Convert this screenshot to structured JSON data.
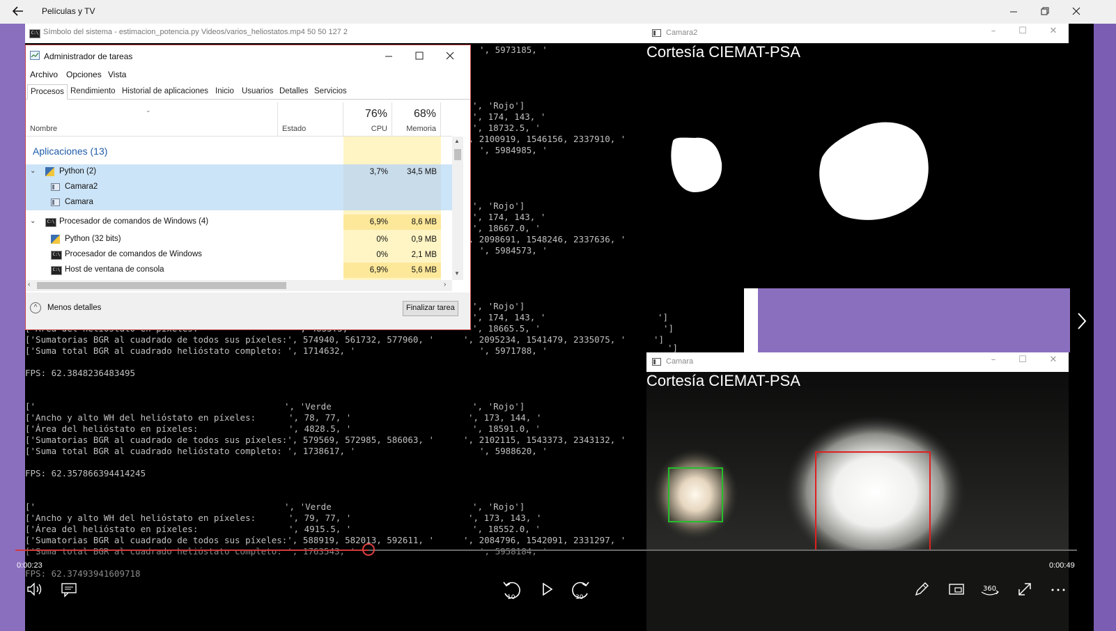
{
  "app": {
    "title": "Películas y TV",
    "back_icon": "arrow-left-icon",
    "caption_buttons": [
      "minimize",
      "restore",
      "close"
    ]
  },
  "console": {
    "title": "Símbolo del sistema - estimacion_potencia.py  Videos/varios_heliostatos.mp4 50 50 127 2",
    "lines": [
      {
        "left": "",
        "right": "', 5973185, '"
      },
      {
        "left": "",
        "right": "', 'Rojo']"
      },
      {
        "left": "",
        "right": "', 174, 143, '"
      },
      {
        "left": "",
        "right": "', 18732.5, '"
      },
      {
        "left": "",
        "right": "', 2100919, 1546156, 2337910, '"
      },
      {
        "left": "",
        "right": "', 5984985, '"
      },
      {
        "left": "",
        "right": "', 'Rojo']"
      },
      {
        "left": "",
        "right": "', 174, 143, '"
      },
      {
        "left": "",
        "right": "', 18667.0, '"
      },
      {
        "left": "",
        "right": "', 2098691, 1548246, 2337636, '"
      },
      {
        "left": "",
        "right": "', 5984573, '"
      },
      {
        "left": "",
        "right": "', 'Rojo']"
      },
      {
        "left": "",
        "right": "', 174, 143, '"
      },
      {
        "left": "['Área del helióstato en píxeles:",
        "mid": "', 4835.5, '",
        "right": "', 18665.5, '"
      },
      {
        "left": "['Sumatorias BGR al cuadrado de todos sus píxeles:', 574940, 561732, 577960, '",
        "right": "', 2095234, 1541479, 2335075, '"
      },
      {
        "left": "['Suma total BGR al cuadrado helióstato completo: ', 1714632, '",
        "right": "', 5971788, '"
      },
      {
        "left": "FPS: 62.3848236483495",
        "right": ""
      },
      {
        "left": "['",
        "mid": "', 'Verde",
        "right": "', 'Rojo']"
      },
      {
        "left": "['Ancho y alto WH del helióstato en píxeles:",
        "mid": "', 78, 77, '",
        "right": "', 173, 144, '"
      },
      {
        "left": "['Área del helióstato en píxeles:",
        "mid": "', 4828.5, '",
        "right": "', 18591.0, '"
      },
      {
        "left": "['Sumatorias BGR al cuadrado de todos sus píxeles:', 579569, 572985, 586063, '",
        "right": "', 2102115, 1543373, 2343132, '"
      },
      {
        "left": "['Suma total BGR al cuadrado helióstato completo: ', 1738617, '",
        "right": "', 5988620, '"
      },
      {
        "left": "FPS: 62.357866394414245",
        "right": ""
      },
      {
        "left": "['",
        "mid": "', 'Verde",
        "right": "', 'Rojo']"
      },
      {
        "left": "['Ancho y alto WH del helióstato en píxeles:",
        "mid": "', 79, 77, '",
        "right": "', 173, 143, '"
      },
      {
        "left": "['Área del helióstato en píxeles:",
        "mid": "', 4915.5, '",
        "right": "', 18552.0, '"
      },
      {
        "left": "['Sumatorias BGR al cuadrado de todos sus píxeles:', 588919, 582013, 592611, '",
        "right": "', 2084796, 1542091, 2331297, '"
      },
      {
        "left": "['Suma total BGR al cuadrado helióstato completo: ', 1763543, '",
        "right": "', 5958184, '"
      },
      {
        "left": "FPS: 62.37493941609718",
        "right": ""
      }
    ],
    "side_fragments": [
      "']",
      "']",
      "']",
      "']"
    ]
  },
  "taskmgr": {
    "title": "Administrador de tareas",
    "menu": [
      "Archivo",
      "Opciones",
      "Vista"
    ],
    "tabs": [
      "Procesos",
      "Rendimiento",
      "Historial de aplicaciones",
      "Inicio",
      "Usuarios",
      "Detalles",
      "Servicios"
    ],
    "columns": {
      "name": "Nombre",
      "status": "Estado",
      "cpu_pct": "76%",
      "cpu": "CPU",
      "mem_pct": "68%",
      "mem": "Memoria"
    },
    "group": "Aplicaciones (13)",
    "rows": [
      {
        "name": "Python (2)",
        "cpu": "3,7%",
        "mem": "34,5 MB"
      },
      {
        "name": "Camara2",
        "cpu": "",
        "mem": ""
      },
      {
        "name": "Camara",
        "cpu": "",
        "mem": ""
      },
      {
        "name": "Procesador de comandos de Windows (4)",
        "cpu": "6,9%",
        "mem": "8,6 MB"
      },
      {
        "name": "Python (32 bits)",
        "cpu": "0%",
        "mem": "0,9 MB"
      },
      {
        "name": "Procesador de comandos de Windows",
        "cpu": "0%",
        "mem": "2,1 MB"
      },
      {
        "name": "Host de ventana de consola",
        "cpu": "6,9%",
        "mem": "5,6 MB"
      }
    ],
    "less_details": "Menos detalles",
    "end_task": "Finalizar tarea"
  },
  "cam2": {
    "title": "Camara2",
    "courtesy": "Cortesía CIEMAT-PSA"
  },
  "cam": {
    "title": "Camara",
    "courtesy": "Cortesía CIEMAT-PSA"
  },
  "player": {
    "elapsed": "0:00:23",
    "total": "0:00:49",
    "progress": 0.333,
    "skip_back": "10",
    "skip_forward": "30",
    "icons": [
      "volume-icon",
      "subtitles-icon",
      "skip-back-10-icon",
      "play-icon",
      "skip-forward-30-icon",
      "pen-icon",
      "mini-view-icon",
      "360-icon",
      "fullscreen-icon",
      "more-icon"
    ]
  },
  "colors": {
    "accent_purple": "#8b6fbf",
    "seek_red": "#d23a3a",
    "box_green": "#22c02a",
    "box_red": "#e02020",
    "tm_select": "#cce4f7",
    "tm_cpu_hl": "#fff4c4"
  }
}
